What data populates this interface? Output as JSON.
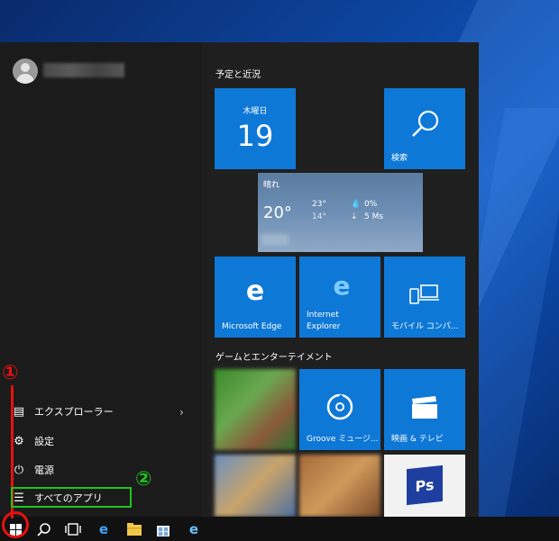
{
  "start_menu": {
    "user_name": "",
    "left_items": [
      {
        "label": "エクスプローラー",
        "icon": "file-explorer-icon"
      },
      {
        "label": "設定",
        "icon": "gear-icon"
      },
      {
        "label": "電源",
        "icon": "power-icon"
      },
      {
        "label": "すべてのアプリ",
        "icon": "all-apps-icon"
      }
    ],
    "groups": [
      {
        "title": "予定と近況"
      },
      {
        "title": "ゲームとエンターテイメント"
      }
    ],
    "calendar": {
      "weekday": "木曜日",
      "day": "19"
    },
    "search_tile": {
      "label": "検索"
    },
    "weather": {
      "condition": "晴れ",
      "temp": "20°",
      "high": "23°",
      "low": "14°",
      "precip": "0%",
      "wind": "5 Ms"
    },
    "tiles_row3": [
      {
        "label": "Microsoft Edge"
      },
      {
        "label_line1": "Internet",
        "label_line2": "Explorer"
      },
      {
        "label": "モバイル コンパ..."
      }
    ],
    "tiles_row4": [
      {
        "label": ""
      },
      {
        "label": "Groove ミュージ..."
      },
      {
        "label": "映画 & テレビ"
      }
    ],
    "tiles_row5": [
      {
        "label": ""
      },
      {
        "label": ""
      },
      {
        "label": "Ps"
      }
    ]
  },
  "annotations": {
    "step1": "①",
    "step2": "②"
  },
  "colors": {
    "tile": "#0e78d7",
    "annotation_red": "#e81010",
    "annotation_green": "#1ec51e"
  }
}
